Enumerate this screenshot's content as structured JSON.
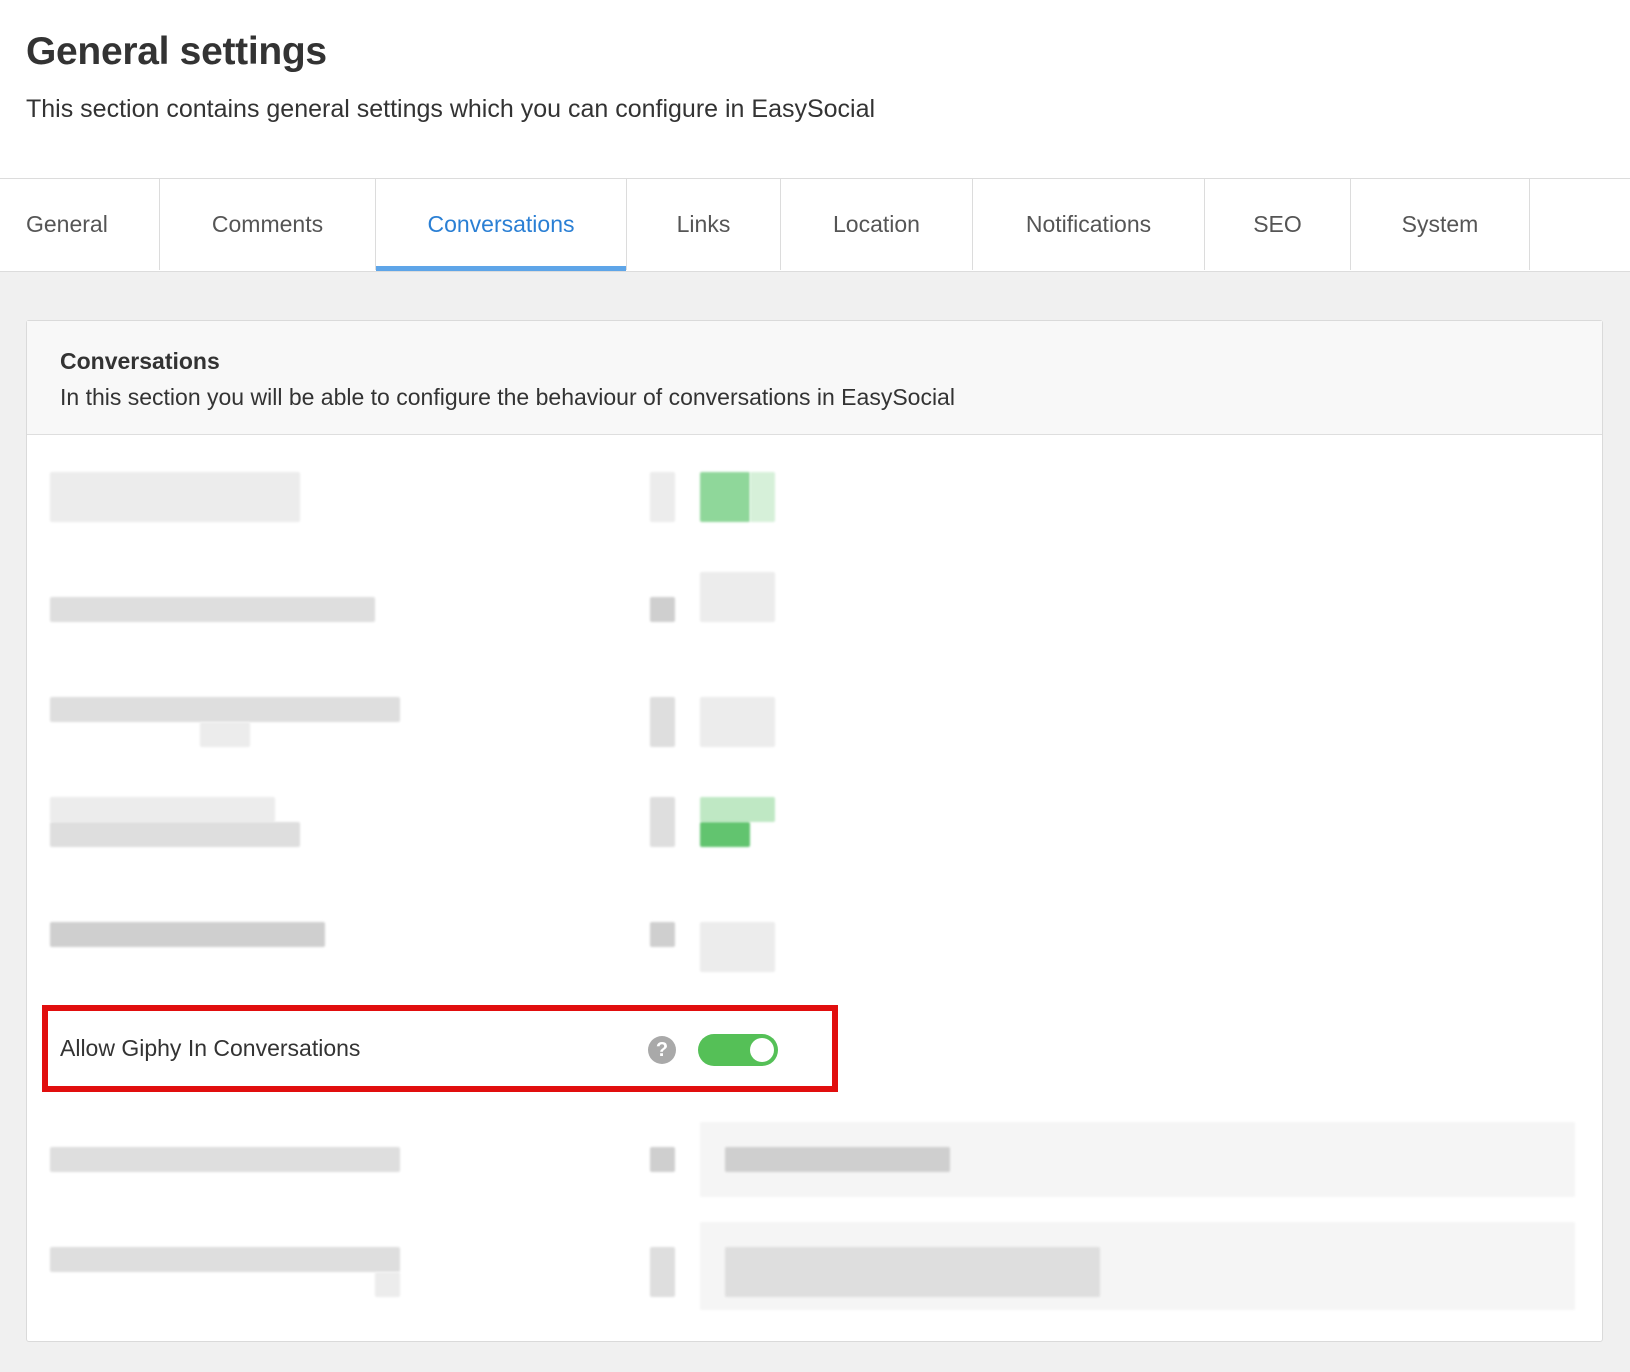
{
  "header": {
    "title": "General settings",
    "description": "This section contains general settings which you can configure in EasySocial"
  },
  "tabs": [
    {
      "label": "General",
      "active": false
    },
    {
      "label": "Comments",
      "active": false
    },
    {
      "label": "Conversations",
      "active": true
    },
    {
      "label": "Links",
      "active": false
    },
    {
      "label": "Location",
      "active": false
    },
    {
      "label": "Notifications",
      "active": false
    },
    {
      "label": "SEO",
      "active": false
    },
    {
      "label": "System",
      "active": false
    }
  ],
  "panel": {
    "title": "Conversations",
    "description": "In this section you will be able to configure the behaviour of conversations in EasySocial"
  },
  "setting": {
    "label": "Allow Giphy In Conversations",
    "help_icon": "question-circle-icon",
    "help_glyph": "?",
    "enabled": true
  },
  "colors": {
    "accent": "#2a7fd4",
    "toggle_on": "#55c057",
    "highlight": "#e10e0e"
  }
}
